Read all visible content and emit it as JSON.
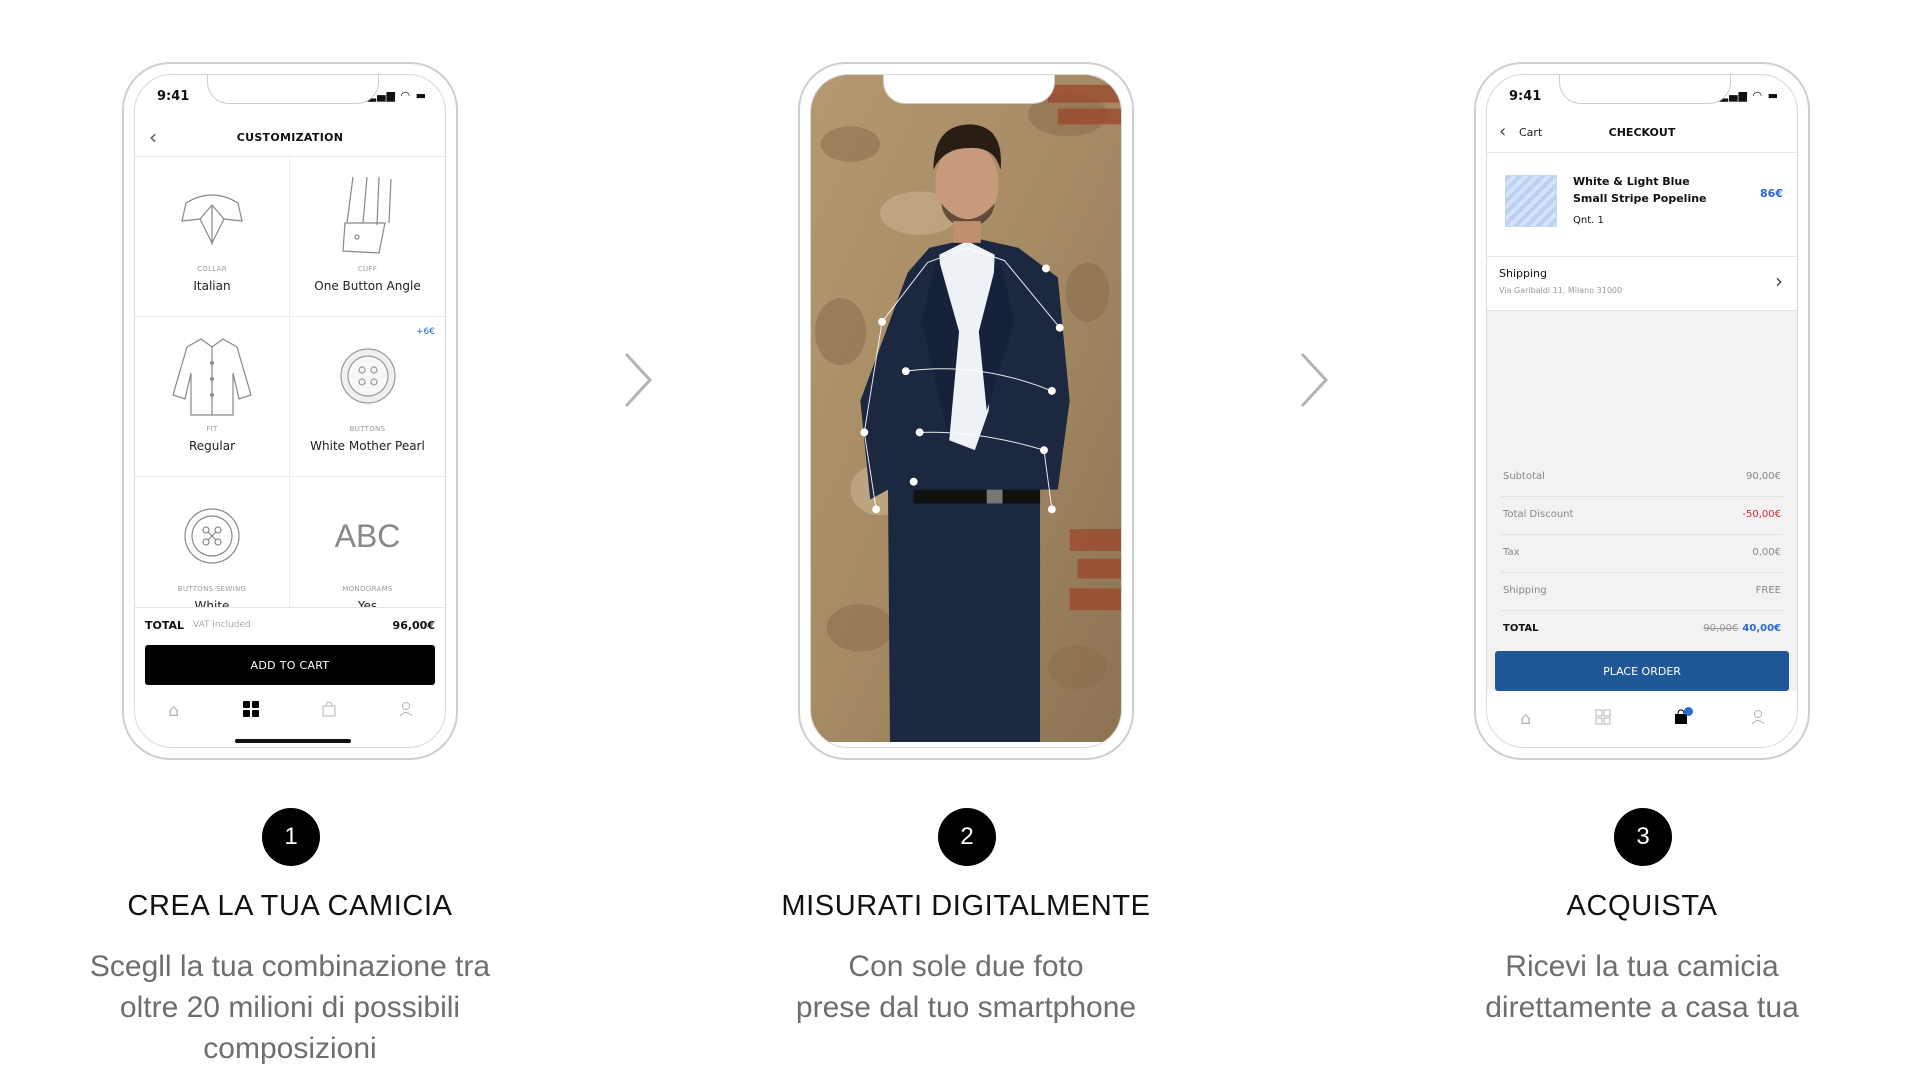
{
  "status": {
    "time": "9:41",
    "icons": "▂▄▆ ◠ ▬"
  },
  "steps": [
    {
      "number": "1",
      "title": "CREA LA TUA CAMICIA",
      "desc": [
        "Scegll la tua combinazione tra",
        "oltre 20 milioni di possibili",
        "composizioni"
      ]
    },
    {
      "number": "2",
      "title": "MISURATI DIGITALMENTE",
      "desc": [
        "Con sole due foto",
        "prese dal tuo smartphone"
      ]
    },
    {
      "number": "3",
      "title": "ACQUISTA",
      "desc": [
        "Ricevi la tua camicia",
        "direttamente a casa tua"
      ]
    }
  ],
  "customization": {
    "title": "CUSTOMIZATION",
    "back_icon": "chevron-left-icon",
    "options": [
      {
        "caption": "COLLAR",
        "value": "Italian",
        "icon": "collar-icon"
      },
      {
        "caption": "CUFF",
        "value": "One Button Angle",
        "icon": "cuff-icon"
      },
      {
        "caption": "FIT",
        "value": "Regular",
        "icon": "shirt-icon"
      },
      {
        "caption": "BUTTONS",
        "value": "White Mother Pearl",
        "badge": "+6€",
        "icon": "button-icon"
      },
      {
        "caption": "BUTTONS SEWING",
        "value": "White",
        "icon": "button-sewing-icon"
      },
      {
        "caption": "MONOGRAMS",
        "value": "Yes",
        "text_icon": "ABC",
        "icon": "monogram-icon"
      }
    ],
    "total_label": "TOTAL",
    "vat_label": "VAT included",
    "total_value": "96,00€",
    "add_to_cart": "ADD TO CART",
    "tabs": [
      "home-icon",
      "grid-icon",
      "bag-icon",
      "user-icon"
    ],
    "active_tab": "grid-icon"
  },
  "measure": {
    "photo": "man-in-navy-suit-photo",
    "photo_colors": {
      "wall": "#a58a64",
      "suit": "#1b2840",
      "shirt": "#eef1f6"
    }
  },
  "checkout": {
    "back_label": "Cart",
    "title": "CHECKOUT",
    "item": {
      "name": "White & Light Blue Small Stripe Popeline",
      "qty": "Qnt. 1",
      "price": "86€"
    },
    "shipping_label": "Shipping",
    "shipping_address": "Via Garibaldi 11, Milano 31000",
    "rows": [
      {
        "label": "Subtotal",
        "value": "90,00€"
      },
      {
        "label": "Total Discount",
        "value": "-50,00€"
      },
      {
        "label": "Tax",
        "value": "0,00€"
      },
      {
        "label": "Shipping",
        "value": "FREE"
      }
    ],
    "total_label": "TOTAL",
    "total_old": "90,00€",
    "total_new": "40,00€",
    "place_order": "PLACE ORDER",
    "tabs": [
      "home-icon",
      "grid-icon",
      "bag-icon",
      "user-icon"
    ],
    "active_tab": "bag-icon"
  },
  "colors": {
    "accent_blue": "#1f5797",
    "link_blue": "#2a6ad1",
    "discount_red": "#d82b2b",
    "step_badge": "#000000"
  }
}
